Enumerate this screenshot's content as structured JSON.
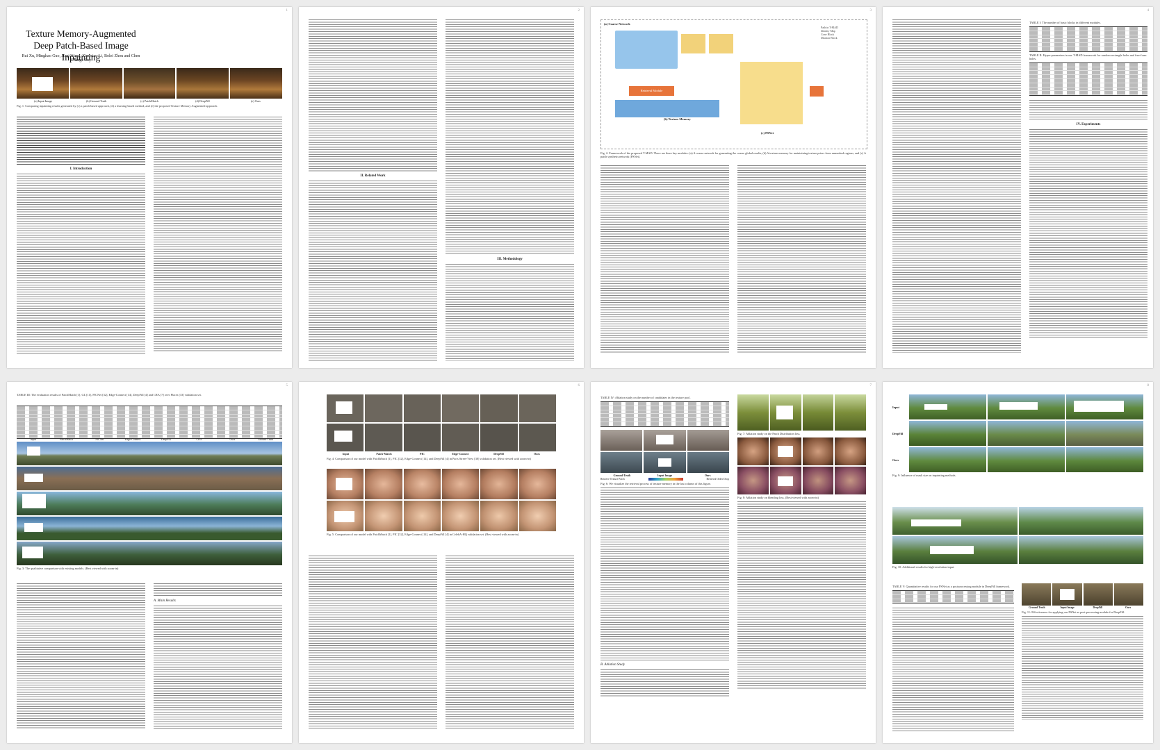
{
  "paper": {
    "title": "Texture Memory-Augmented Deep Patch-Based Image Inpainting",
    "authors": "Rui Xu, Minghao Guo, Jiaqi Wang, Xiaoxiao Li, Bolei Zhou and Chen Change Loy"
  },
  "page_numbers": [
    "1",
    "2",
    "3",
    "4",
    "5",
    "6",
    "7",
    "8"
  ],
  "headings": {
    "intro": "I. Introduction",
    "related": "II. Related Work",
    "method": "III. Methodology",
    "experiments": "IV. Experiments",
    "ablation": "B. Ablation Study",
    "main_results": "A. Main Results"
  },
  "captions": {
    "fig1": "Fig. 1: Comparing inpainting results generated by (c) a patch-based approach, (d) a learning-based method, and (e) the proposed Texture Memory Augmented approach.",
    "fig1_labels": [
      "(a) Input Image",
      "(b) Ground-Truth",
      "(c) PatchMatch",
      "(d) DeepFill",
      "(e) Ours"
    ],
    "fig2": "Fig. 2: Framework of the proposed T-MAD. There are three key modules: (a) A coarse network for generating the coarse global results, (b) A texture memory for maintaining texture priors from unmasked regions, and (c) A patch synthesis network (PSNet).",
    "fig2_labels": [
      "(a) Coarse Network",
      "(b) Texture Memory",
      "(c) PSNet",
      "Retrieval Module"
    ],
    "fig2_legend": [
      "Path in T-MAD",
      "Identity Map",
      "Conv Block",
      "Dilation Block"
    ],
    "table1": "TABLE I: The number of basic blocks in different modules.",
    "table2": "TABLE II: Hyper-parameters in our T-MAD framework for random rectangle holes and free-form holes.",
    "table3": "TABLE III: The evaluation results of PatchMatch [1], GL [11], PICNet [32], Edge-Connect [14], DeepFill [4] and CRA [7] over Places [33] validation set.",
    "fig3_labels": [
      "Input",
      "PatchMatch",
      "PICNet",
      "Edge-Connect",
      "DeepFill",
      "CRA",
      "Ours",
      "Ground-Truth"
    ],
    "fig3": "Fig. 3: The qualitative comparison with existing models. (Best viewed with zoom-in)",
    "fig4_labels": [
      "Input",
      "Patch-Match",
      "PIC",
      "Edge-Connect",
      "DeepFill",
      "Ours"
    ],
    "fig4": "Fig. 4: Comparison of our model with PatchMatch [1], PIC [32], Edge-Connect [14], and DeepFill [4] in Paris Street-View [38] validation set. (Best viewed with zoom-in)",
    "fig5": "Fig. 5: Comparison of our model with PatchMatch [1], PIC [32], Edge-Connect [14], and DeepFill [4] in CelebA-HQ validation set. (Best viewed with zoom-in)",
    "table4": "TABLE IV: Ablation study on the number of candidates in the texture pool.",
    "fig6": "Fig. 6: We visualize the retrieval process of texture memory in the last column of this figure.",
    "fig6_labels": [
      "Ground-Truth",
      "Input Image",
      "Ours",
      "Retrieve Texture Patch",
      "Retrieval Order Drop"
    ],
    "fig7": "Fig. 7: Ablation study on the Patch Distribution loss.",
    "fig8": "Fig. 8: Ablation study on blending loss. (Best viewed with zoom-in)",
    "fig9_labels": [
      "Input",
      "DeepFill",
      "Ours"
    ],
    "fig9": "Fig. 9: Influence of mask size on inpainting methods.",
    "fig10": "Fig. 10: Additional results for high-resolution input.",
    "fig11_labels": [
      "Ground-Truth",
      "Input Image",
      "DeepFill",
      "Ours"
    ],
    "fig11": "Fig. 11: Effectiveness for applying our PSNet as post-processing module for DeepFill.",
    "table5": "TABLE V: Quantitative results for our PSNet as a post-processing module in DeepFill framework."
  }
}
